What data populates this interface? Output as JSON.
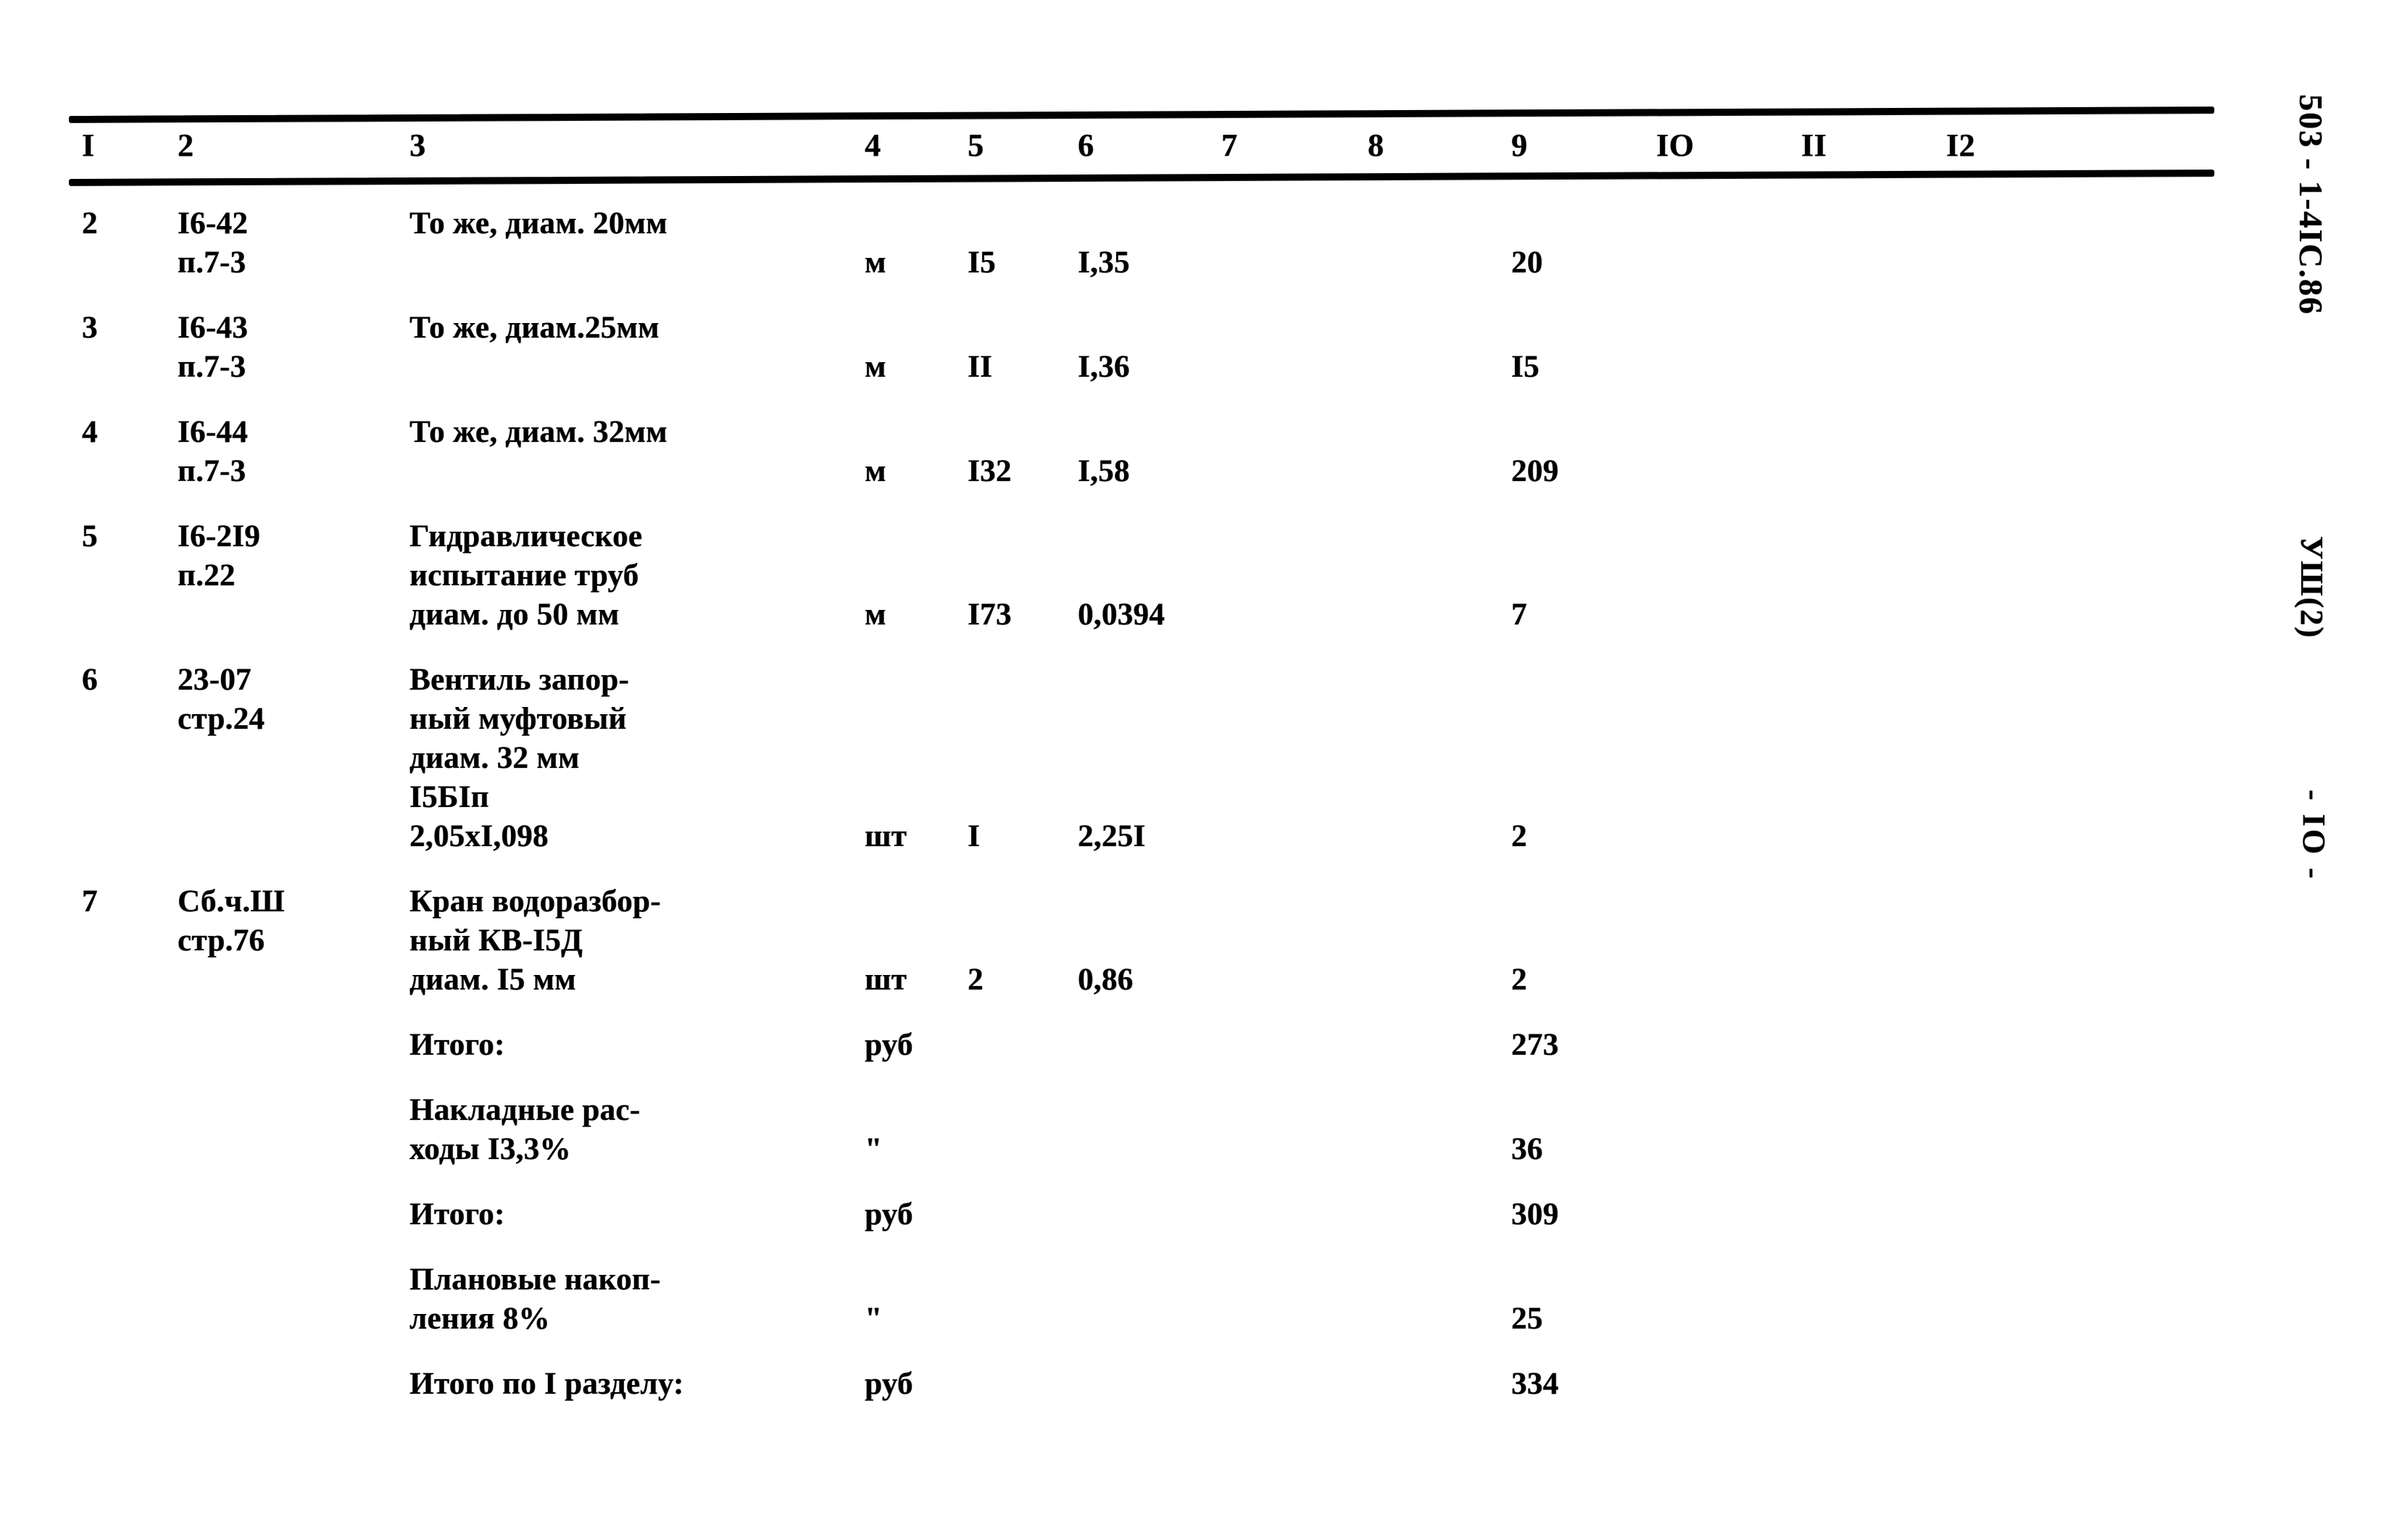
{
  "document": {
    "code": "503 - 1-4IC.86",
    "section": "УШ(2)",
    "page_number": "- IO -"
  },
  "table": {
    "headers": [
      "I",
      "2",
      "3",
      "4",
      "5",
      "6",
      "7",
      "8",
      "9",
      "IO",
      "II",
      "I2"
    ],
    "rows": [
      {
        "no": "2",
        "ref_line1": "I6-42",
        "ref_line2": "п.7-3",
        "description": "То же, диам. 20мм",
        "unit": "м",
        "c5": "I5",
        "c6": "I,35",
        "c7": "",
        "c8": "",
        "c9": "20",
        "c10": "",
        "c11": "",
        "c12": ""
      },
      {
        "no": "3",
        "ref_line1": "I6-43",
        "ref_line2": "п.7-3",
        "description": "То же, диам.25мм",
        "unit": "м",
        "c5": "II",
        "c6": "I,36",
        "c7": "",
        "c8": "",
        "c9": "I5",
        "c10": "",
        "c11": "",
        "c12": ""
      },
      {
        "no": "4",
        "ref_line1": "I6-44",
        "ref_line2": "п.7-3",
        "description": "То же, диам. 32мм",
        "unit": "м",
        "c5": "I32",
        "c6": "I,58",
        "c7": "",
        "c8": "",
        "c9": "209",
        "c10": "",
        "c11": "",
        "c12": ""
      },
      {
        "no": "5",
        "ref_line1": "I6-2I9",
        "ref_line2": "п.22",
        "description": "Гидравлическое\nиспытание труб\nдиам. до 50 мм",
        "unit": "м",
        "c5": "I73",
        "c6": "0,0394",
        "c7": "",
        "c8": "",
        "c9": "7",
        "c10": "",
        "c11": "",
        "c12": ""
      },
      {
        "no": "6",
        "ref_line1": "23-07",
        "ref_line2": "стр.24",
        "description": "Вентиль запор-\nный муфтовый\nдиам. 32 мм\nI5БIп\n2,05хI,098",
        "unit": "шт",
        "c5": "I",
        "c6": "2,25I",
        "c7": "",
        "c8": "",
        "c9": "2",
        "c10": "",
        "c11": "",
        "c12": ""
      },
      {
        "no": "7",
        "ref_line1": "Сб.ч.Ш",
        "ref_line2": "стр.76",
        "description": "Кран водоразбор-\nный КВ-I5Д\nдиам. I5 мм",
        "unit": "шт",
        "c5": "2",
        "c6": "0,86",
        "c7": "",
        "c8": "",
        "c9": "2",
        "c10": "",
        "c11": "",
        "c12": ""
      }
    ],
    "summary_rows": [
      {
        "no": "",
        "ref_line1": "",
        "ref_line2": "",
        "description": "Итого:",
        "unit": "руб",
        "c5": "",
        "c6": "",
        "c7": "",
        "c8": "",
        "c9": "273",
        "c10": "",
        "c11": "",
        "c12": ""
      },
      {
        "no": "",
        "ref_line1": "",
        "ref_line2": "",
        "description": "Накладные рас-\nходы I3,3%",
        "unit": "\"",
        "c5": "",
        "c6": "",
        "c7": "",
        "c8": "",
        "c9": "36",
        "c10": "",
        "c11": "",
        "c12": ""
      },
      {
        "no": "",
        "ref_line1": "",
        "ref_line2": "",
        "description": "Итого:",
        "unit": "руб",
        "c5": "",
        "c6": "",
        "c7": "",
        "c8": "",
        "c9": "309",
        "c10": "",
        "c11": "",
        "c12": ""
      },
      {
        "no": "",
        "ref_line1": "",
        "ref_line2": "",
        "description": "Плановые накоп-\nления 8%",
        "unit": "\"",
        "c5": "",
        "c6": "",
        "c7": "",
        "c8": "",
        "c9": "25",
        "c10": "",
        "c11": "",
        "c12": ""
      },
      {
        "no": "",
        "ref_line1": "",
        "ref_line2": "",
        "description": "Итого по I разделу:",
        "unit": "руб",
        "c5": "",
        "c6": "",
        "c7": "",
        "c8": "",
        "c9": "334",
        "c10": "",
        "c11": "",
        "c12": ""
      }
    ]
  }
}
